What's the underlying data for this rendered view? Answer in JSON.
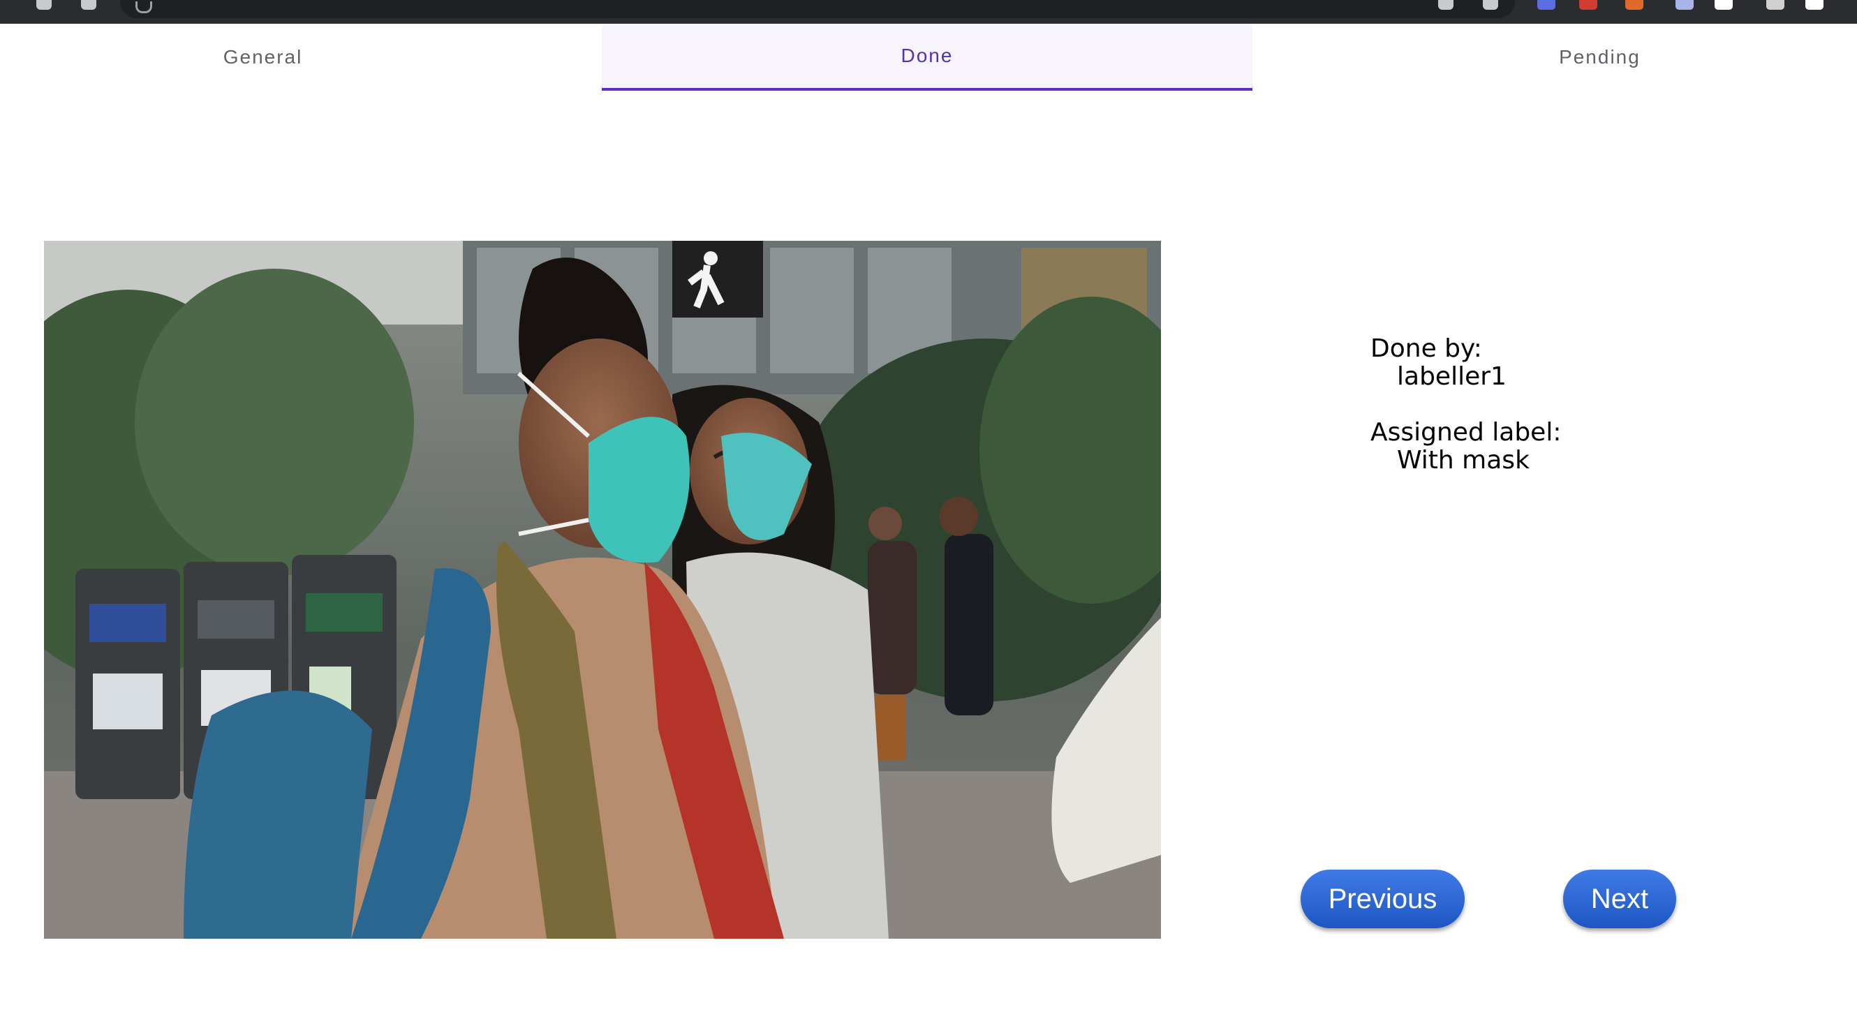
{
  "tabs": [
    {
      "label": "General",
      "active": false
    },
    {
      "label": "Done",
      "active": true
    },
    {
      "label": "Pending",
      "active": false
    }
  ],
  "image": {
    "alt": "Two women wearing face masks on a city street"
  },
  "info": {
    "done_by_label": "Done by:",
    "done_by_value": "labeller1",
    "assigned_label_label": "Assigned label:",
    "assigned_label_value": "With mask"
  },
  "buttons": {
    "previous": "Previous",
    "next": "Next"
  },
  "colors": {
    "accent": "#5d2fc4",
    "active_tab_bg": "#f7f5fb",
    "button_blue": "#2a63d1"
  }
}
